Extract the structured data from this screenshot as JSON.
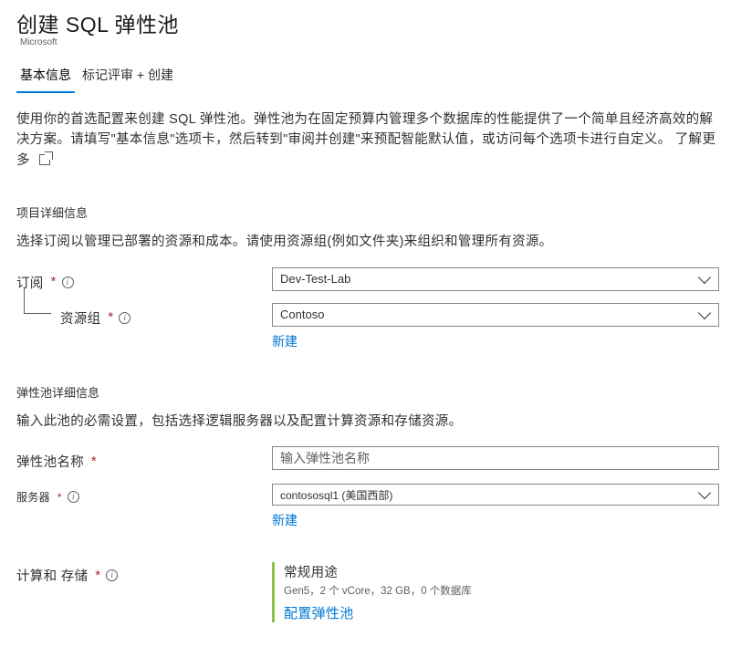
{
  "header": {
    "title": "创建 SQL 弹性池",
    "brand": "Microsoft"
  },
  "tabs": {
    "basic": "基本信息",
    "tags": "标记评审 + 创建"
  },
  "intro": {
    "text": "使用你的首选配置来创建 SQL 弹性池。弹性池为在固定预算内管理多个数据库的性能提供了一个简单且经济高效的解决方案。请填写\"基本信息\"选项卡，然后转到\"审阅并创建\"来预配智能默认值，或访问每个选项卡进行自定义。",
    "learn_more": "了解更多"
  },
  "project": {
    "section_title": "项目详细信息",
    "section_desc": "选择订阅以管理已部署的资源和成本。请使用资源组(例如文件夹)来组织和管理所有资源。",
    "subscription_label": "订阅",
    "subscription_value": "Dev-Test-Lab",
    "resource_group_label": "资源组",
    "resource_group_value": "Contoso",
    "create_new": "新建"
  },
  "pool": {
    "section_title": "弹性池详细信息",
    "section_desc": "输入此池的必需设置，包括选择逻辑服务器以及配置计算资源和存储资源。",
    "name_label": "弹性池名称",
    "name_placeholder": "输入弹性池名称",
    "server_label": "服务器",
    "server_value": "contososql1 (美国西部)",
    "create_new": "新建"
  },
  "compute": {
    "label": "计算和 存储",
    "tier": "常规用途",
    "spec": "Gen5，2 个 vCore，32 GB，0 个数据库",
    "configure": "配置弹性池"
  }
}
